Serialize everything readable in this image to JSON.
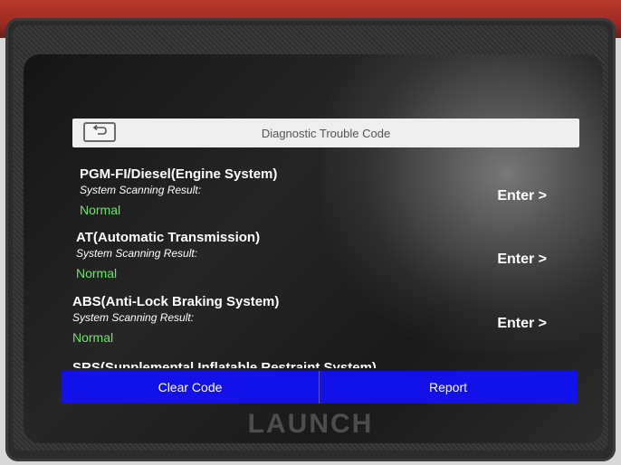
{
  "header": {
    "title": "Diagnostic Trouble Code"
  },
  "systems": [
    {
      "name": "PGM-FI/Diesel(Engine System)",
      "label": "System Scanning Result:",
      "status": "Normal",
      "action": "Enter >"
    },
    {
      "name": "AT(Automatic Transmission)",
      "label": "System Scanning Result:",
      "status": "Normal",
      "action": "Enter >"
    },
    {
      "name": "ABS(Anti-Lock Braking System)",
      "label": "System Scanning Result:",
      "status": "Normal",
      "action": "Enter >"
    }
  ],
  "partial_item": "SRS(Supplemental Inflatable Restraint System)",
  "footer": {
    "clear_label": "Clear Code",
    "report_label": "Report"
  },
  "device": {
    "brand": "LAUNCH"
  },
  "colors": {
    "accent": "#1212e8",
    "normal": "#6ee36e"
  },
  "icons": {
    "back": "back-arrow-icon"
  }
}
